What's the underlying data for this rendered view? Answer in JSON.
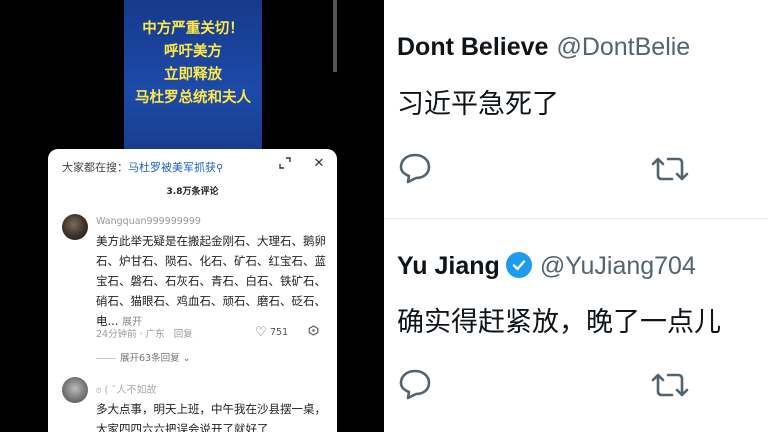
{
  "video": {
    "lines": [
      "中方严重关切！",
      "呼吁美方",
      "立即释放",
      "马杜罗总统和夫人"
    ]
  },
  "comments_panel": {
    "search_prefix": "大家都在搜：",
    "search_keyword": "马杜罗被美军抓获",
    "comment_count": "3.8万条评论",
    "comment1": {
      "user": "Wangquan999999999",
      "text": "美方此举无疑是在搬起金刚石、大理石、鹅卵石、炉甘石、陨石、化石、矿石、红宝石、蓝宝石、磐石、石灰石、青石、白石、铁矿石、硝石、猫眼石、鸡血石、顽石、磨石、砭石、电...",
      "more_label": "展开",
      "time": "24分钟前",
      "location": "广东",
      "reply_label": "回复",
      "likes": "751"
    },
    "expand_replies": "展开63条回复",
    "comment2": {
      "user": "ಠ ( ˘人不如故",
      "text": "多大点事，明天上班，中午我在沙县摆一桌，大家四四六六把误会说开了就好了"
    }
  },
  "tweets": [
    {
      "name": "Dont Believe",
      "handle": "@DontBelie",
      "verified": false,
      "text": "习近平急死了"
    },
    {
      "name": "Yu Jiang",
      "handle": "@YuJiang704",
      "verified": true,
      "text": "确实得赶紧放，晚了一点儿"
    }
  ],
  "colors": {
    "twitter_blue": "#1d9bf0",
    "link_blue": "#1f5fbf",
    "video_text": "#ffe94a"
  }
}
